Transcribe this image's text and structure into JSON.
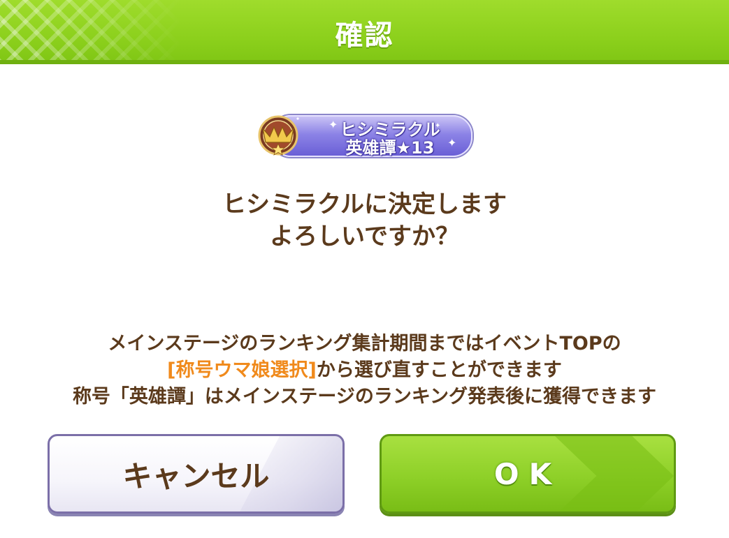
{
  "dialog": {
    "title": "確認",
    "badge": {
      "line1": "ヒシミラクル",
      "line2": "英雄譚★13"
    },
    "question_line1": "ヒシミラクルに決定します",
    "question_line2": "よろしいですか？",
    "info_line1": "メインステージのランキング集計期間まではイベントTOPの",
    "info_line2_highlight": "[称号ウマ娘選択]",
    "info_line2_rest": "から選び直すことができます",
    "info_line3": "称号「英雄譚」はメインステージのランキング発表後に獲得できます"
  },
  "buttons": {
    "cancel_label": "キャンセル",
    "ok_label": "OK"
  },
  "colors": {
    "header_green": "#8cd01c",
    "text_brown": "#5b3a1c",
    "highlight_orange": "#f08a1c",
    "badge_purple": "#8c83e6"
  },
  "icons": {
    "badge_emblem": "title-medal-icon"
  }
}
